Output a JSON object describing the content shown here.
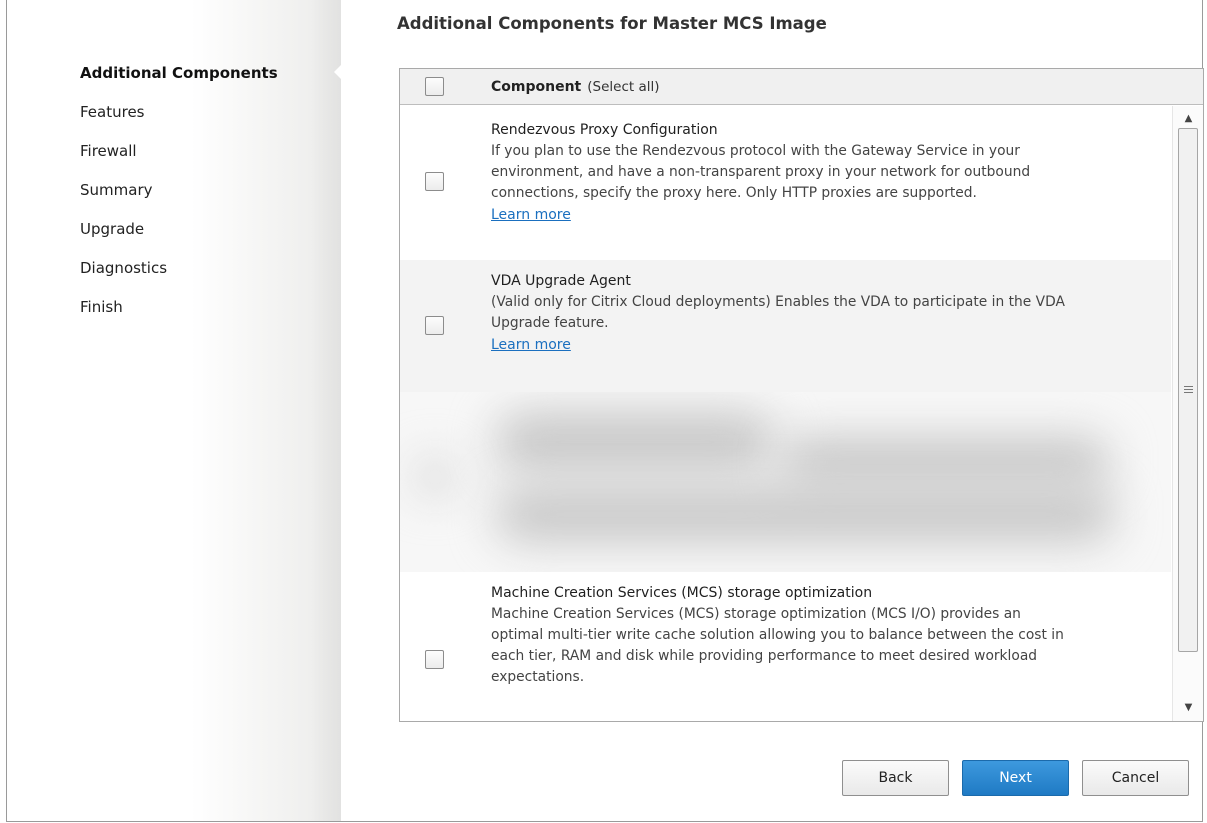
{
  "sidebar": {
    "items": [
      {
        "label": "Additional Components",
        "active": true
      },
      {
        "label": "Features",
        "active": false
      },
      {
        "label": "Firewall",
        "active": false
      },
      {
        "label": "Summary",
        "active": false
      },
      {
        "label": "Upgrade",
        "active": false
      },
      {
        "label": "Diagnostics",
        "active": false
      },
      {
        "label": "Finish",
        "active": false
      }
    ]
  },
  "main": {
    "title": "Additional Components for Master MCS Image",
    "table": {
      "column_header": "Component",
      "select_all_label": "(Select all)",
      "select_all_checked": false
    },
    "components": [
      {
        "title": "Rendezvous Proxy Configuration",
        "description_lines": [
          "If you plan to use the Rendezvous protocol with the Gateway Service in your",
          "environment, and have a non-transparent proxy in your network for outbound",
          "connections, specify the proxy here. Only HTTP proxies are supported."
        ],
        "link": "Learn more ",
        "checked": false
      },
      {
        "title": "VDA Upgrade Agent",
        "description_lines": [
          "(Valid only for Citrix Cloud deployments) Enables the VDA to participate in the VDA",
          "Upgrade feature."
        ],
        "link": "Learn more ",
        "checked": false
      },
      {
        "title": "Machine Creation Services (MCS) storage optimization",
        "description_lines": [
          "Machine Creation Services (MCS) storage optimization (MCS I/O) provides an",
          "optimal multi-tier write cache solution allowing you to balance between the cost in",
          "each tier, RAM and disk while providing performance to meet desired workload",
          "expectations."
        ],
        "checked": false
      }
    ],
    "scrollbar": {
      "up_icon": "triangle-up",
      "down_icon": "triangle-down",
      "position_fraction": 0.0
    }
  },
  "footer": {
    "back_label": "Back",
    "next_label": "Next",
    "cancel_label": "Cancel"
  },
  "colors": {
    "primary_button": "#2a86d1",
    "link": "#1a6fbf",
    "header_bg": "#f0f0f0",
    "row_shade": "#f3f3f3"
  }
}
